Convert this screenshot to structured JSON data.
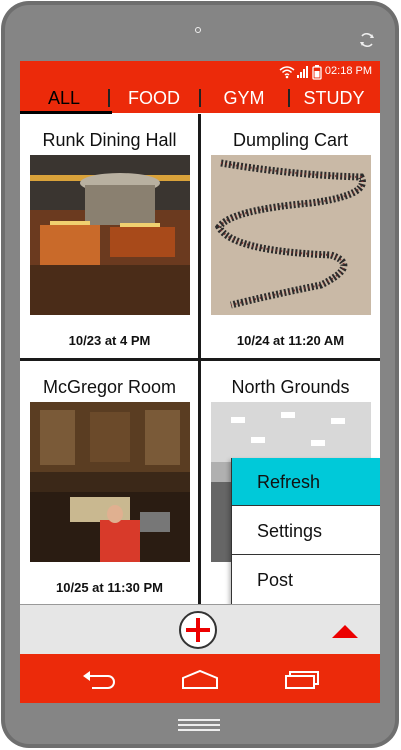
{
  "status_bar": {
    "time": "02:18 PM",
    "icons": [
      "wifi-icon",
      "signal-icon",
      "battery-icon"
    ]
  },
  "tabs": [
    {
      "label": "ALL",
      "active": true
    },
    {
      "label": "FOOD",
      "active": false
    },
    {
      "label": "GYM",
      "active": false
    },
    {
      "label": "STUDY",
      "active": false
    }
  ],
  "cards": [
    {
      "title": "Runk Dining Hall",
      "date": "10/23 at 4 PM",
      "image": "dining-hall-photo"
    },
    {
      "title": "Dumpling Cart",
      "date": "10/24 at 11:20 AM",
      "image": "queue-line-photo"
    },
    {
      "title": "McGregor Room",
      "date": "10/25 at 11:30 PM",
      "image": "library-room-photo"
    },
    {
      "title": "North Grounds",
      "date": "",
      "image": "gym-photo"
    }
  ],
  "menu": {
    "items": [
      {
        "label": "Refresh",
        "highlighted": true
      },
      {
        "label": "Settings",
        "highlighted": false
      },
      {
        "label": "Post",
        "highlighted": false
      }
    ]
  },
  "bottom_bar": {
    "add_icon": "plus-icon",
    "up_icon": "triangle-up-icon"
  },
  "nav_bar": {
    "icons": [
      "back-icon",
      "home-icon",
      "recent-apps-icon"
    ]
  },
  "colors": {
    "accent": "#ec2a0a",
    "highlight": "#00c9d9",
    "plus": "#ec0000"
  }
}
